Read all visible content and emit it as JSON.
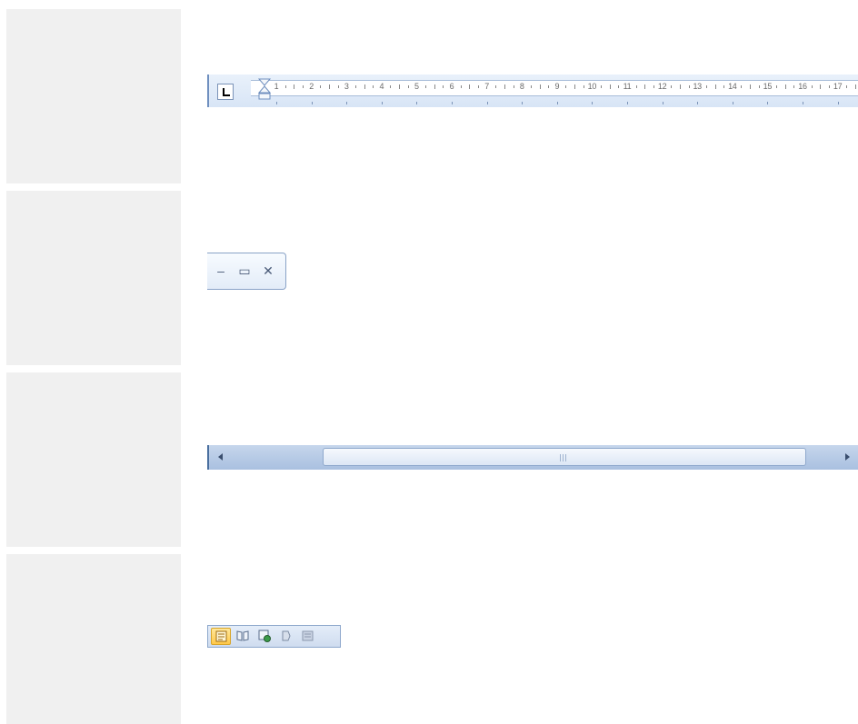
{
  "ruler": {
    "numbers": [
      "1",
      "2",
      "3",
      "4",
      "5",
      "6",
      "7",
      "8",
      "9",
      "10",
      "11",
      "12",
      "13",
      "14",
      "15",
      "16",
      "17"
    ],
    "tab_selector_icon": "left-tab-stop-icon",
    "indent_icon": "hanging-indent-marker-icon",
    "accent": "#d8e5f6"
  },
  "window_controls": {
    "minimize": "–",
    "maximize": "▭",
    "close": "✕",
    "icons": [
      "minimize-icon",
      "maximize-icon",
      "close-icon"
    ]
  },
  "scrollbar": {
    "icons": [
      "scroll-left-arrow-icon",
      "scroll-right-arrow-icon",
      "thumb-grip-icon"
    ],
    "color": "#a9c0e0",
    "thumb_position": 0.17,
    "thumb_fraction": 0.75
  },
  "view_buttons": {
    "items": [
      {
        "name": "print-layout-view",
        "icon": "print-layout-icon",
        "active": true
      },
      {
        "name": "full-screen-reading-view",
        "icon": "full-screen-reading-icon",
        "active": false
      },
      {
        "name": "web-layout-view",
        "icon": "web-layout-icon",
        "active": false
      },
      {
        "name": "outline-view",
        "icon": "outline-icon",
        "active": false
      },
      {
        "name": "draft-view",
        "icon": "draft-icon",
        "active": false
      }
    ],
    "active_color": "#ffc84a"
  }
}
